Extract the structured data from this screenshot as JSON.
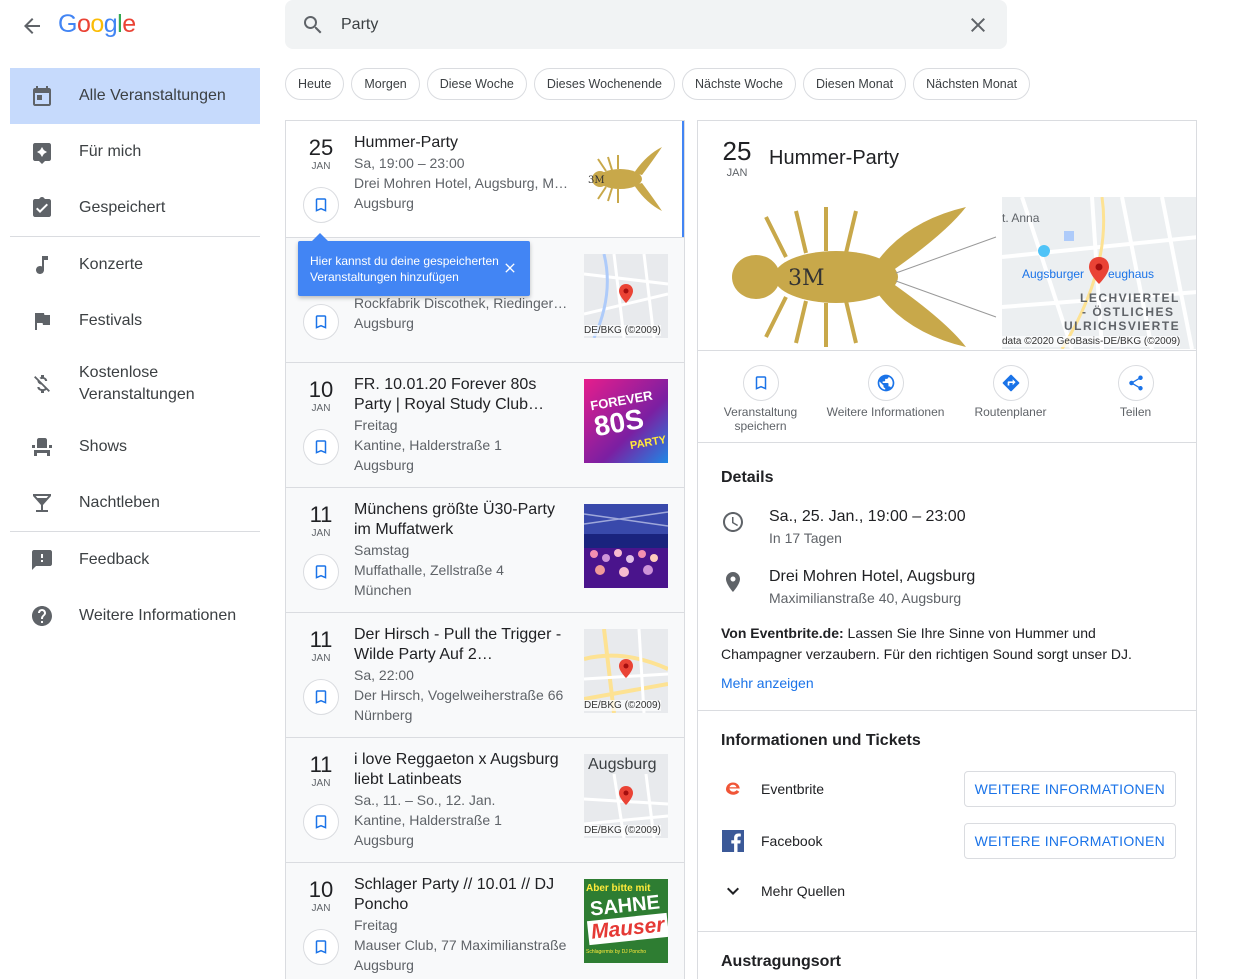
{
  "header": {
    "logo": [
      "G",
      "o",
      "o",
      "g",
      "l",
      "e"
    ],
    "logo_colors": [
      "#4285f4",
      "#ea4335",
      "#fbbc05",
      "#4285f4",
      "#34a853",
      "#ea4335"
    ],
    "search_value": "Party"
  },
  "sidebar": {
    "items": [
      {
        "label": "Alle Veranstaltungen",
        "icon": "calendar-icon",
        "active": true
      },
      {
        "label": "Für mich",
        "icon": "sparkle-calendar-icon"
      },
      {
        "label": "Gespeichert",
        "icon": "saved-check-icon"
      },
      {
        "label": "Konzerte",
        "icon": "music-note-icon"
      },
      {
        "label": "Festivals",
        "icon": "flag-icon"
      },
      {
        "label": "Kostenlose Veranstaltungen",
        "icon": "money-off-icon"
      },
      {
        "label": "Shows",
        "icon": "seat-icon"
      },
      {
        "label": "Nachtleben",
        "icon": "cocktail-icon"
      },
      {
        "label": "Feedback",
        "icon": "feedback-icon"
      },
      {
        "label": "Weitere Informationen",
        "icon": "help-icon"
      }
    ]
  },
  "chips": [
    "Heute",
    "Morgen",
    "Diese Woche",
    "Dieses Wochenende",
    "Nächste Woche",
    "Diesen Monat",
    "Nächsten Monat"
  ],
  "tooltip": "Hier kannst du deine gespeicherten Veranstaltungen hinzufügen",
  "events": [
    {
      "day": "25",
      "month": "JAN",
      "title": "Hummer-Party",
      "lines": [
        "Sa, 19:00 – 23:00",
        "Drei Mohren Hotel, Augsburg, Ma…",
        "Augsburg"
      ],
      "thumb": "lobster"
    },
    {
      "day": "",
      "month": "",
      "title": "",
      "lines": [
        "Rockfabrik Discothek, Riedingers…",
        "Augsburg"
      ],
      "thumb": "map",
      "map_credit": "DE/BKG (©2009)"
    },
    {
      "day": "10",
      "month": "JAN",
      "title": "FR. 10.01.20 Forever 80s Party | Royal Study Club…",
      "lines": [
        "Freitag",
        "Kantine, Halderstraße 1",
        "Augsburg"
      ],
      "thumb": "forever80s",
      "thumb_text": [
        "FOREVER",
        "80S",
        "PARTY"
      ]
    },
    {
      "day": "11",
      "month": "JAN",
      "title": "Münchens größte Ü30-Party im Muffatwerk",
      "lines": [
        "Samstag",
        "Muffathalle, Zellstraße 4",
        "München"
      ],
      "thumb": "crowd"
    },
    {
      "day": "11",
      "month": "JAN",
      "title": "Der Hirsch - Pull the Trigger - Wilde Party Auf 2…",
      "lines": [
        "Sa, 22:00",
        "Der Hirsch, Vogelweiherstraße 66",
        "Nürnberg"
      ],
      "thumb": "map",
      "map_credit": "DE/BKG (©2009)"
    },
    {
      "day": "11",
      "month": "JAN",
      "title": "i love Reggaeton x Augsburg liebt Latinbeats",
      "lines": [
        "Sa., 11. – So., 12. Jan.",
        "Kantine, Halderstraße 1",
        "Augsburg"
      ],
      "thumb": "map",
      "map_title": "Augsburg",
      "map_credit": "DE/BKG (©2009)"
    },
    {
      "day": "10",
      "month": "JAN",
      "title": "Schlager Party // 10.01 // DJ Poncho",
      "lines": [
        "Freitag",
        "Mauser Club, 77 Maximilianstraße",
        "Augsburg"
      ],
      "thumb": "mauser",
      "thumb_text": [
        "Aber bitte mit",
        "SAHNE",
        "Mauser",
        "Schlagermix by DJ Poncho"
      ]
    }
  ],
  "detail": {
    "day": "25",
    "month": "JAN",
    "title": "Hummer-Party",
    "hero_text": "3M",
    "map": {
      "labels": [
        "t. Anna",
        "Augsburger",
        "eughaus",
        "LECHVIERTEL",
        "- ÖSTLICHES",
        "ULRICHSVIERTE"
      ],
      "credit": "data ©2020 GeoBasis-DE/BKG (©2009)"
    },
    "actions": [
      {
        "label": "Veranstaltung speichern",
        "icon": "bookmark-icon"
      },
      {
        "label": "Weitere Informationen",
        "icon": "globe-icon"
      },
      {
        "label": "Routenplaner",
        "icon": "directions-icon"
      },
      {
        "label": "Teilen",
        "icon": "share-icon"
      }
    ],
    "details_title": "Details",
    "time_main": "Sa., 25. Jan., 19:00 – 23:00",
    "time_sub": "In 17 Tagen",
    "place_main": "Drei Mohren Hotel, Augsburg",
    "place_sub": "Maximilianstraße 40, Augsburg",
    "desc_source": "Von Eventbrite.de:",
    "desc_text": " Lassen Sie Ihre Sinne von Hummer und Champagner verzaubern. Für den richtigen Sound sorgt unser DJ.",
    "show_more": "Mehr anzeigen",
    "tickets_title": "Informationen und Tickets",
    "sources": [
      {
        "name": "Eventbrite",
        "button": "WEITERE INFORMATIONEN",
        "icon": "eventbrite-icon"
      },
      {
        "name": "Facebook",
        "button": "WEITERE INFORMATIONEN",
        "icon": "facebook-icon"
      }
    ],
    "more_sources": "Mehr Quellen",
    "venue_title": "Austragungsort"
  },
  "colors": {
    "accent": "#4285f4",
    "link": "#1a73e8",
    "active_nav": "#c6dafc",
    "pin": "#ea4335"
  }
}
